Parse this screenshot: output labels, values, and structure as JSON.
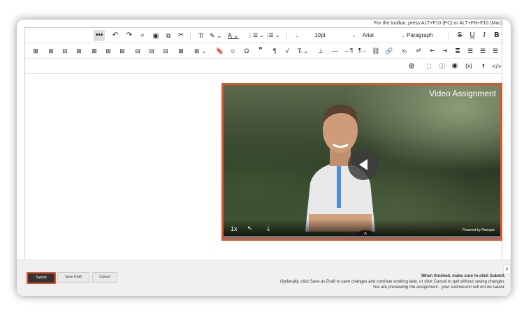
{
  "toolbar_hint": "For the toolbar, press ALT+F10 (PC) or ALT+FN+F10 (Mac).",
  "toolbar": {
    "row1": [
      "B",
      "I",
      "U",
      "S",
      "Paragraph",
      "Arial",
      "10pt",
      "☰",
      "☰",
      "A",
      "✎",
      "T̲",
      "✂",
      "⎘",
      "📋",
      "🔍",
      "↷",
      "↶",
      "•••"
    ],
    "paragraph_label": "Paragraph",
    "font_label": "Arial",
    "size_label": "10pt"
  },
  "video": {
    "title": "Video Assignment",
    "powered_by": "Powered by Panopto",
    "speed": "1x"
  },
  "footer": {
    "instruction_1": "When finished, make sure to click Submit.",
    "instruction_2": "Optionally, click Save as Draft to save changes and continue working later, or click Cancel to quit without saving changes.",
    "instruction_3": "You are previewing the assignment - your submission will not be saved.",
    "cancel_label": "Cancel",
    "save_draft_label": "Save Draft",
    "submit_label": "Submit",
    "side_tab": "p"
  }
}
